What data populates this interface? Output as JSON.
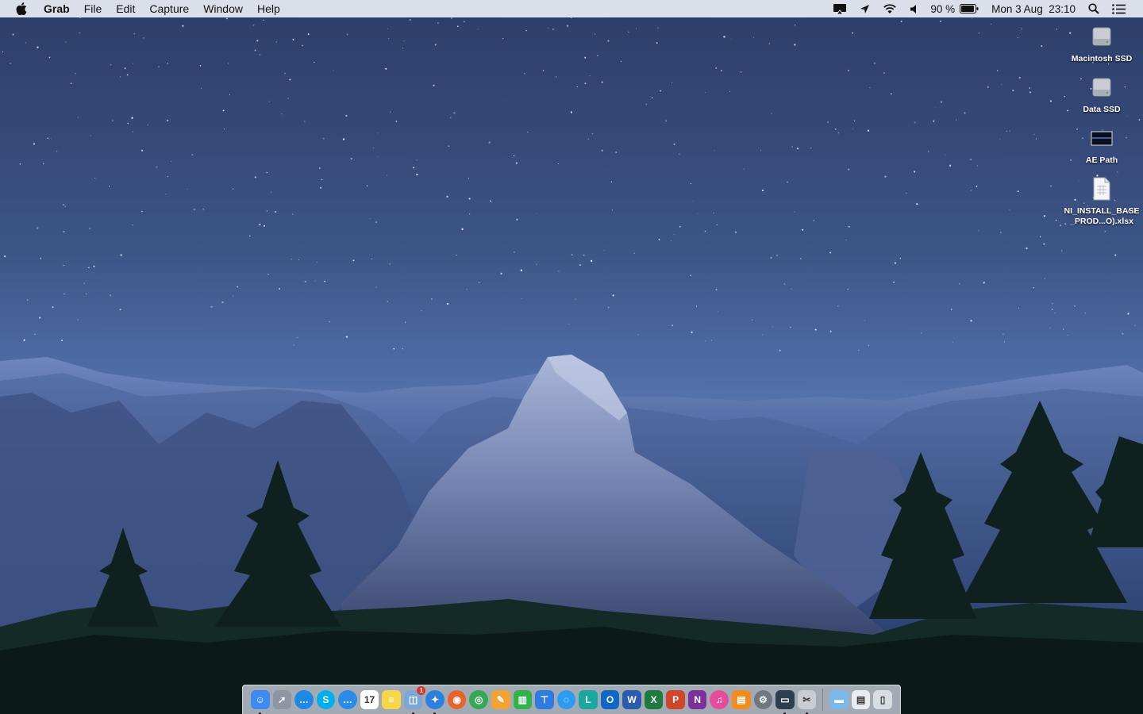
{
  "menubar": {
    "app_name": "Grab",
    "menus": [
      "File",
      "Edit",
      "Capture",
      "Window",
      "Help"
    ],
    "status": {
      "battery_percent": "90 %",
      "clock": "Mon 3 Aug  23:10"
    }
  },
  "desktop": {
    "icons": [
      {
        "label": "Macintosh SSD",
        "icon": "drive-icon"
      },
      {
        "label": "Data SSD",
        "icon": "drive-icon"
      },
      {
        "label": "AE Path",
        "icon": "image-thumbnail-icon"
      },
      {
        "label": "NI_INSTALL_BASE_PROD...O).xlsx",
        "icon": "xlsx-document-icon"
      }
    ]
  },
  "dock": {
    "apps": [
      {
        "name": "Finder",
        "icon": "finder-icon",
        "color": "#3d8bf0",
        "glyph": "☺",
        "running": true
      },
      {
        "name": "Launchpad",
        "icon": "rocket-icon",
        "color": "#8e96a3",
        "glyph": "➚",
        "running": false
      },
      {
        "name": "Messenger",
        "icon": "chat-bubble-icon",
        "color": "#1e88e5",
        "glyph": "…",
        "running": false
      },
      {
        "name": "Skype",
        "icon": "skype-icon",
        "color": "#00aff0",
        "glyph": "S",
        "running": false
      },
      {
        "name": "Messages Alt",
        "icon": "message-dots-icon",
        "color": "#2b8ce8",
        "glyph": "…",
        "running": false
      },
      {
        "name": "Calendar",
        "icon": "calendar-icon",
        "color": "#ffffff",
        "glyph": "17",
        "running": false
      },
      {
        "name": "Notes",
        "icon": "notes-icon",
        "color": "#f7d74a",
        "glyph": "≡",
        "running": false
      },
      {
        "name": "Preview",
        "icon": "preview-icon",
        "color": "#7aa7d9",
        "glyph": "◫",
        "running": true,
        "badge": "1"
      },
      {
        "name": "Safari",
        "icon": "compass-icon",
        "color": "#2d7fe0",
        "glyph": "✦",
        "running": true
      },
      {
        "name": "Firefox",
        "icon": "firefox-icon",
        "color": "#e8622a",
        "glyph": "◉",
        "running": false
      },
      {
        "name": "Chrome",
        "icon": "chrome-icon",
        "color": "#34a853",
        "glyph": "◎",
        "running": false
      },
      {
        "name": "Pages",
        "icon": "pages-icon",
        "color": "#f3a233",
        "glyph": "✎",
        "running": false
      },
      {
        "name": "Numbers",
        "icon": "bar-chart-icon",
        "color": "#2fb34a",
        "glyph": "▥",
        "running": false
      },
      {
        "name": "Keynote",
        "icon": "podium-icon",
        "color": "#2f7ce0",
        "glyph": "⊤",
        "running": false
      },
      {
        "name": "Messages",
        "icon": "speech-bubble-icon",
        "color": "#2b9cf2",
        "glyph": "◌",
        "running": false
      },
      {
        "name": "Lync",
        "icon": "lync-icon",
        "color": "#19a8a0",
        "glyph": "L",
        "running": false
      },
      {
        "name": "Outlook",
        "icon": "outlook-icon",
        "color": "#1167c6",
        "glyph": "O",
        "running": false
      },
      {
        "name": "Word",
        "icon": "word-icon",
        "color": "#2b5bae",
        "glyph": "W",
        "running": false
      },
      {
        "name": "Excel",
        "icon": "excel-icon",
        "color": "#1f7a40",
        "glyph": "X",
        "running": false
      },
      {
        "name": "PowerPoint",
        "icon": "powerpoint-icon",
        "color": "#d0462a",
        "glyph": "P",
        "running": false
      },
      {
        "name": "OneNote",
        "icon": "onenote-icon",
        "color": "#7b3199",
        "glyph": "N",
        "running": false
      },
      {
        "name": "iTunes",
        "icon": "music-note-icon",
        "color": "#e64b9c",
        "glyph": "♫",
        "running": false
      },
      {
        "name": "iBooks",
        "icon": "book-icon",
        "color": "#f28c1d",
        "glyph": "▤",
        "running": false
      },
      {
        "name": "System Preferences",
        "icon": "gear-icon",
        "color": "#6f7780",
        "glyph": "⚙",
        "running": false
      },
      {
        "name": "Display",
        "icon": "monitor-icon",
        "color": "#2c3e50",
        "glyph": "▭",
        "running": true
      },
      {
        "name": "Grab",
        "icon": "grab-icon",
        "color": "#c9ccd1",
        "glyph": "✂",
        "running": true
      }
    ],
    "others": [
      {
        "name": "Applications",
        "icon": "folder-icon",
        "color": "#7ab8ea",
        "glyph": "▬"
      },
      {
        "name": "Downloads",
        "icon": "downloads-stack-icon",
        "color": "#e9edf2",
        "glyph": "▤"
      },
      {
        "name": "Trash",
        "icon": "trash-icon",
        "color": "#d8dde4",
        "glyph": "▯"
      }
    ]
  }
}
